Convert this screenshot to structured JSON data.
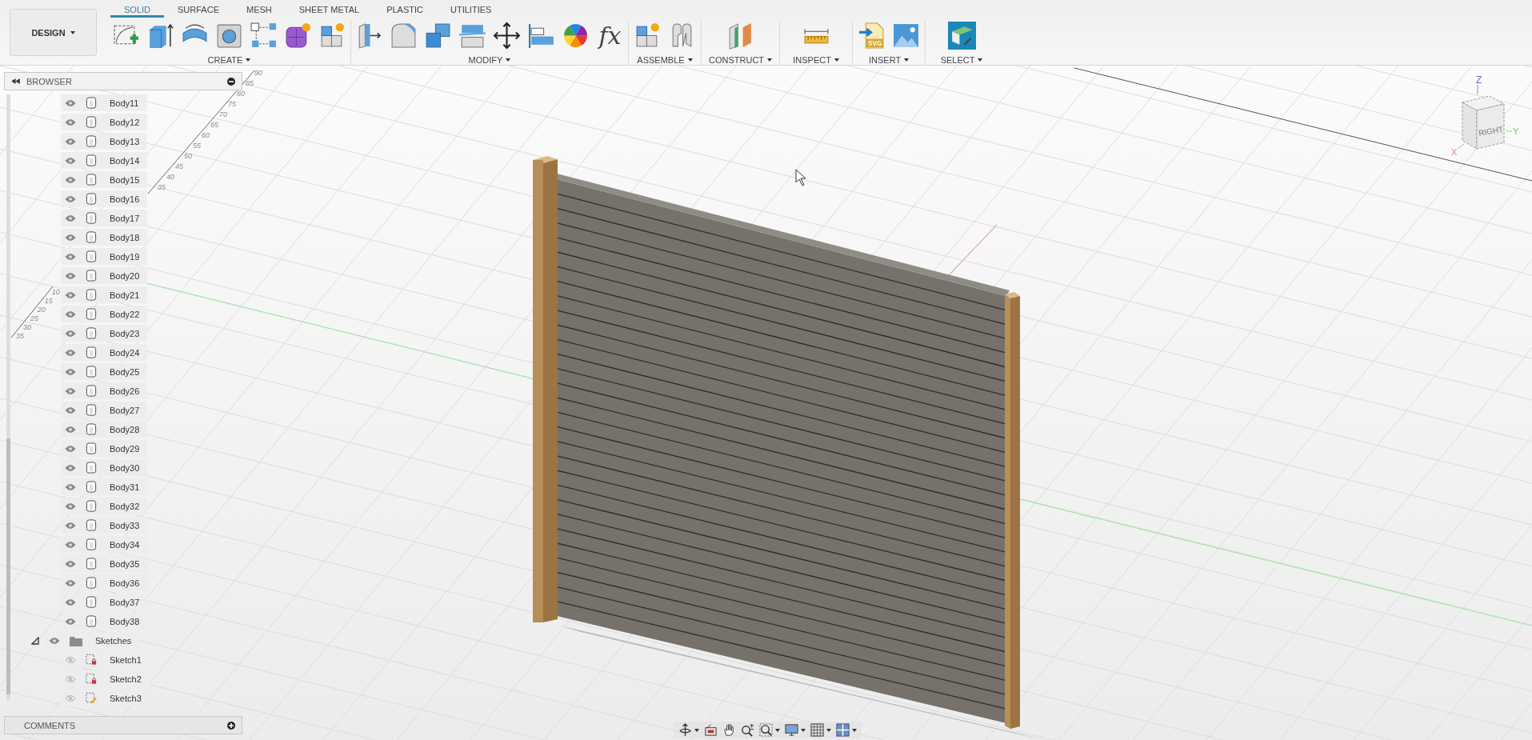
{
  "workspace": {
    "label": "DESIGN"
  },
  "tabs": [
    {
      "label": "SOLID",
      "selected": true
    },
    {
      "label": "SURFACE",
      "selected": false
    },
    {
      "label": "MESH",
      "selected": false
    },
    {
      "label": "SHEET METAL",
      "selected": false
    },
    {
      "label": "PLASTIC",
      "selected": false
    },
    {
      "label": "UTILITIES",
      "selected": false
    }
  ],
  "tool_groups": [
    {
      "label": "CREATE",
      "tools": [
        {
          "kind": "sketch"
        },
        {
          "kind": "extrude"
        },
        {
          "kind": "revolve"
        },
        {
          "kind": "hole"
        },
        {
          "kind": "pattern"
        },
        {
          "kind": "form"
        },
        {
          "kind": "component"
        }
      ]
    },
    {
      "label": "MODIFY",
      "tools": [
        {
          "kind": "presspull"
        },
        {
          "kind": "fillet"
        },
        {
          "kind": "combine"
        },
        {
          "kind": "split"
        },
        {
          "kind": "move"
        },
        {
          "kind": "align"
        },
        {
          "kind": "appearance"
        },
        {
          "kind": "parameters",
          "glyph": "fx"
        }
      ]
    },
    {
      "label": "ASSEMBLE",
      "tools": [
        {
          "kind": "component"
        },
        {
          "kind": "joint"
        }
      ]
    },
    {
      "label": "CONSTRUCT",
      "tools": [
        {
          "kind": "plane"
        }
      ]
    },
    {
      "label": "INSPECT",
      "tools": [
        {
          "kind": "measure"
        }
      ]
    },
    {
      "label": "INSERT",
      "tools": [
        {
          "kind": "svg",
          "glyph": "SVG"
        },
        {
          "kind": "image"
        }
      ]
    },
    {
      "label": "SELECT",
      "tools": [
        {
          "kind": "select"
        }
      ]
    }
  ],
  "browser": {
    "title": "BROWSER",
    "items": [
      {
        "kind": "body",
        "label": "Body11",
        "visible": true
      },
      {
        "kind": "body",
        "label": "Body12",
        "visible": true
      },
      {
        "kind": "body",
        "label": "Body13",
        "visible": true
      },
      {
        "kind": "body",
        "label": "Body14",
        "visible": true
      },
      {
        "kind": "body",
        "label": "Body15",
        "visible": true
      },
      {
        "kind": "body",
        "label": "Body16",
        "visible": true
      },
      {
        "kind": "body",
        "label": "Body17",
        "visible": true
      },
      {
        "kind": "body",
        "label": "Body18",
        "visible": true
      },
      {
        "kind": "body",
        "label": "Body19",
        "visible": true
      },
      {
        "kind": "body",
        "label": "Body20",
        "visible": true
      },
      {
        "kind": "body",
        "label": "Body21",
        "visible": true
      },
      {
        "kind": "body",
        "label": "Body22",
        "visible": true
      },
      {
        "kind": "body",
        "label": "Body23",
        "visible": true
      },
      {
        "kind": "body",
        "label": "Body24",
        "visible": true
      },
      {
        "kind": "body",
        "label": "Body25",
        "visible": true
      },
      {
        "kind": "body",
        "label": "Body26",
        "visible": true
      },
      {
        "kind": "body",
        "label": "Body27",
        "visible": true
      },
      {
        "kind": "body",
        "label": "Body28",
        "visible": true
      },
      {
        "kind": "body",
        "label": "Body29",
        "visible": true
      },
      {
        "kind": "body",
        "label": "Body30",
        "visible": true
      },
      {
        "kind": "body",
        "label": "Body31",
        "visible": true
      },
      {
        "kind": "body",
        "label": "Body32",
        "visible": true
      },
      {
        "kind": "body",
        "label": "Body33",
        "visible": true
      },
      {
        "kind": "body",
        "label": "Body34",
        "visible": true
      },
      {
        "kind": "body",
        "label": "Body35",
        "visible": true
      },
      {
        "kind": "body",
        "label": "Body36",
        "visible": true
      },
      {
        "kind": "body",
        "label": "Body37",
        "visible": true
      },
      {
        "kind": "body",
        "label": "Body38",
        "visible": true
      },
      {
        "kind": "folder",
        "label": "Sketches",
        "visible": true,
        "expanded": true,
        "children": [
          {
            "kind": "sketch",
            "label": "Sketch1",
            "visible": false,
            "locked": true
          },
          {
            "kind": "sketch",
            "label": "Sketch2",
            "visible": false,
            "locked": true
          },
          {
            "kind": "sketch",
            "label": "Sketch3",
            "visible": false,
            "locked": false
          }
        ]
      }
    ]
  },
  "comments": {
    "title": "COMMENTS"
  },
  "viewcube": {
    "face": "RIGHT",
    "axes": [
      "Z",
      "X",
      "Y"
    ]
  },
  "ruler_back": [
    "90",
    "85",
    "80",
    "75",
    "70",
    "65",
    "60",
    "55",
    "50",
    "45",
    "40",
    "35"
  ],
  "ruler_front": [
    "10",
    "15",
    "20",
    "25",
    "30",
    "35"
  ]
}
